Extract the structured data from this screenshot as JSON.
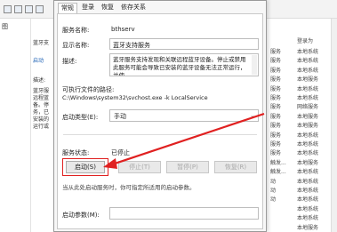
{
  "console": {
    "left_label": "图",
    "mid_items": [
      "蓝牙支",
      "启动",
      "描述:",
      "蓝牙服",
      "远程蓝",
      "备。停",
      "务，已",
      "安装的",
      "运行或"
    ],
    "right_header": "登录为",
    "right_cells": [
      {
        "status": "服务",
        "login": "本地系统"
      },
      {
        "status": "服务",
        "login": "本地系统"
      },
      {
        "status": "服务",
        "login": "本地系统"
      },
      {
        "status": "服务",
        "login": "本地服务"
      },
      {
        "status": "服务",
        "login": "本地系统"
      },
      {
        "status": "服务",
        "login": "本地系统"
      },
      {
        "status": "服务",
        "login": "网络服务"
      },
      {
        "status": "服务",
        "login": "本地服务"
      },
      {
        "status": "服务",
        "login": "本地服务"
      },
      {
        "status": "服务",
        "login": "本地系统"
      },
      {
        "status": "服务",
        "login": "本地系统"
      },
      {
        "status": "服务",
        "login": "本地系统"
      },
      {
        "status": "触发...",
        "login": "本地服务"
      },
      {
        "status": "触发...",
        "login": "本地系统"
      },
      {
        "status": "动",
        "login": "本地系统"
      },
      {
        "status": "动",
        "login": "本地系统"
      },
      {
        "status": "动",
        "login": "本地系统"
      },
      {
        "status": "",
        "login": "本地系统"
      },
      {
        "status": "",
        "login": "本地系统"
      },
      {
        "status": "",
        "login": "本地服务"
      }
    ]
  },
  "dialog": {
    "tabs": [
      "常规",
      "登录",
      "恢复",
      "依存关系"
    ],
    "service_name_label": "服务名称:",
    "service_name": "bthserv",
    "display_name_label": "显示名称:",
    "display_name": "蓝牙支持服务",
    "description_label": "描述:",
    "description": "蓝牙服务支持发现和关联远程蓝牙设备。停止或禁用此服务可能会导致已安装的蓝牙设备无法正常运行，并使",
    "exe_path_label": "可执行文件的路径:",
    "exe_path": "C:\\Windows\\system32\\svchost.exe -k LocalService",
    "startup_type_label": "启动类型(E):",
    "startup_type": "手动",
    "status_label": "服务状态:",
    "status_value": "已停止",
    "buttons": {
      "start": "启动(S)",
      "stop": "停止(T)",
      "pause": "暂停(P)",
      "resume": "恢复(R)"
    },
    "hint": "当从此处启动服务时，你可指定所适用的启动参数。",
    "params_label": "启动参数(M):",
    "params_value": ""
  },
  "colors": {
    "highlight": "#e02020"
  }
}
